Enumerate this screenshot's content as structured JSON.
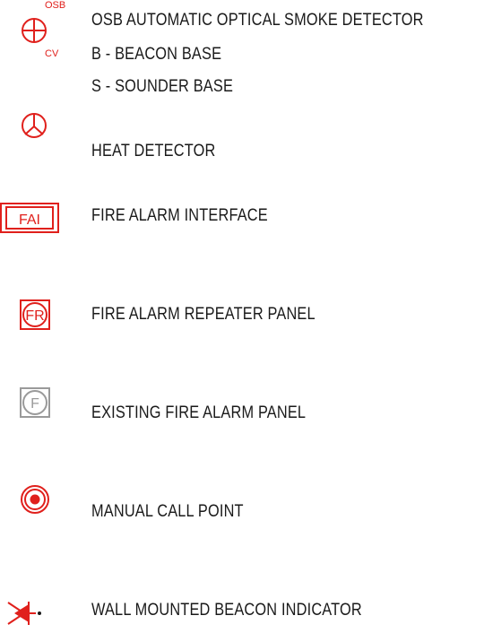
{
  "legend": {
    "smoke": {
      "line1": "OSB AUTOMATIC OPTICAL SMOKE DETECTOR",
      "line2": "B - BEACON BASE",
      "line3": "S - SOUNDER BASE",
      "tag_top": "OSB",
      "tag_bottom": "CV",
      "icon": "smoke-detector-icon"
    },
    "heat": {
      "label": "HEAT DETECTOR",
      "icon": "heat-detector-icon"
    },
    "fai": {
      "label": "FIRE ALARM INTERFACE",
      "icon_text": "FAI",
      "icon": "fire-alarm-interface-icon"
    },
    "repeater": {
      "label": "FIRE ALARM REPEATER PANEL",
      "icon_text": "FR",
      "icon": "fire-alarm-repeater-icon"
    },
    "existing": {
      "label": "EXISTING FIRE ALARM PANEL",
      "icon_text": "F",
      "icon": "existing-fire-alarm-panel-icon"
    },
    "callpoint": {
      "label": "MANUAL CALL POINT",
      "icon": "manual-call-point-icon"
    },
    "beacon": {
      "label": "WALL MOUNTED BEACON INDICATOR",
      "icon": "wall-beacon-icon"
    }
  },
  "colors": {
    "symbol_red": "#e0201c",
    "existing_gray": "#9a9a9a",
    "text": "#1a1a1a"
  }
}
